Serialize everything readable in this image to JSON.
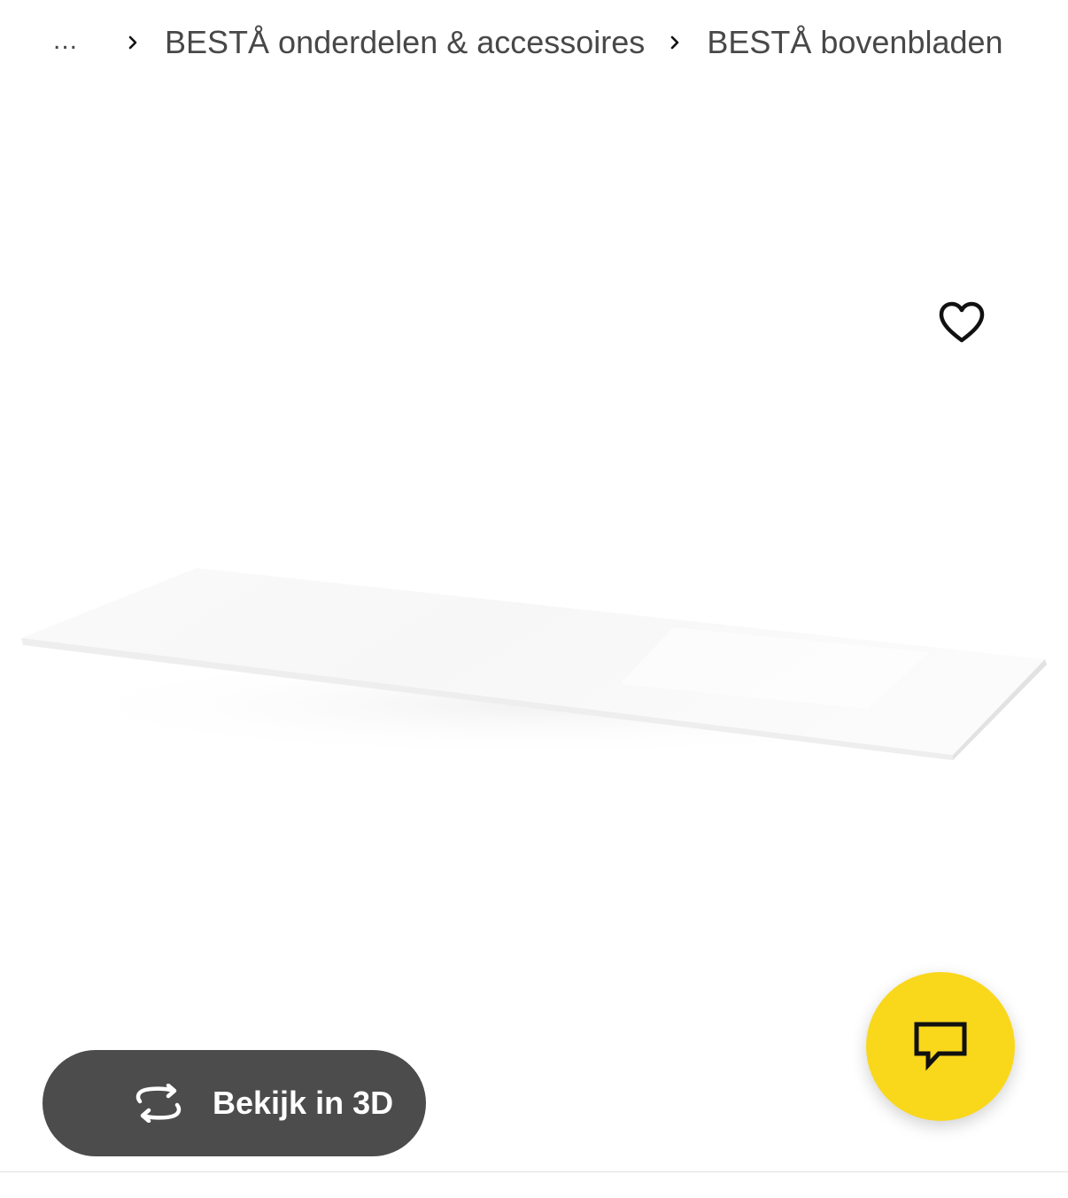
{
  "breadcrumb": {
    "ellipsis": "...",
    "items": [
      {
        "label": "BESTÅ onderdelen & accessoires"
      },
      {
        "label": "BESTÅ bovenbladen"
      }
    ]
  },
  "product": {
    "image_icon": "white-tabletop-image",
    "favourite_icon": "heart-outline-icon"
  },
  "view_3d": {
    "label": "Bekijk in 3D",
    "icon": "rotate-3d-icon",
    "background": "#4c4c4c"
  },
  "chat": {
    "icon": "chat-bubble-icon",
    "background": "#f9d71b"
  }
}
